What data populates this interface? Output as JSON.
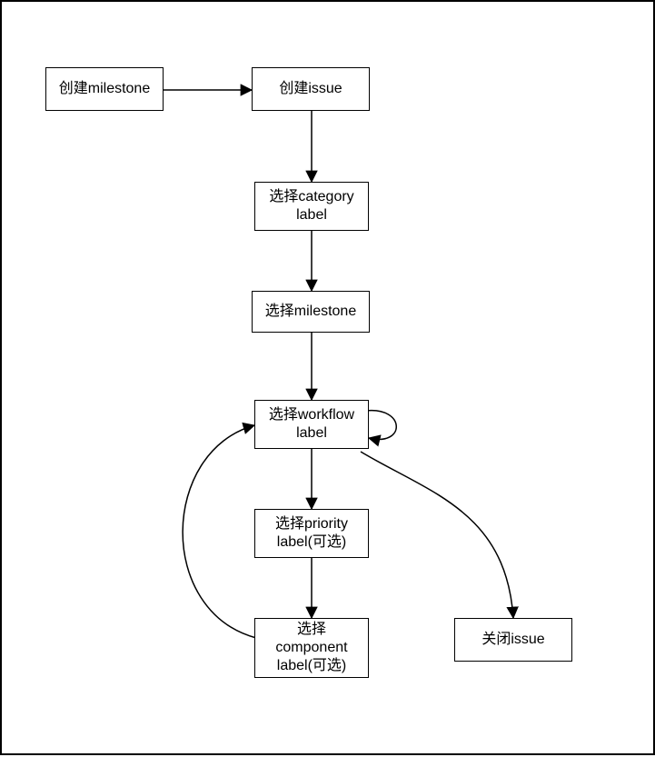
{
  "nodes": {
    "create_milestone": "创建milestone",
    "create_issue": "创建issue",
    "choose_category_label": "选择category label",
    "choose_milestone": "选择milestone",
    "choose_workflow_label": "选择workflow label",
    "choose_priority_label": "选择priority label(可选)",
    "choose_component_label": "选择 component label(可选)",
    "close_issue": "关闭issue"
  },
  "edges": [
    {
      "from": "create_milestone",
      "to": "create_issue"
    },
    {
      "from": "create_issue",
      "to": "choose_category_label"
    },
    {
      "from": "choose_category_label",
      "to": "choose_milestone"
    },
    {
      "from": "choose_milestone",
      "to": "choose_workflow_label"
    },
    {
      "from": "choose_workflow_label",
      "to": "choose_workflow_label"
    },
    {
      "from": "choose_workflow_label",
      "to": "choose_priority_label"
    },
    {
      "from": "choose_workflow_label",
      "to": "close_issue"
    },
    {
      "from": "choose_priority_label",
      "to": "choose_component_label"
    },
    {
      "from": "choose_component_label",
      "to": "choose_workflow_label"
    }
  ]
}
